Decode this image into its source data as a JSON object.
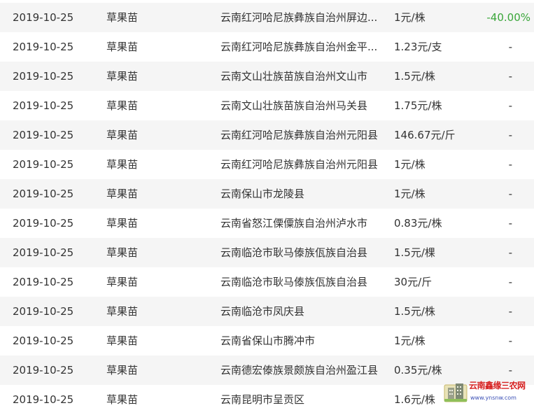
{
  "rows": [
    {
      "date": "2019-10-25",
      "product": "草果苗",
      "region": "云南红河哈尼族彝族自治州屏边...",
      "price": "1元/株",
      "change": "-40.00%"
    },
    {
      "date": "2019-10-25",
      "product": "草果苗",
      "region": "云南红河哈尼族彝族自治州金平...",
      "price": "1.23元/支",
      "change": "-"
    },
    {
      "date": "2019-10-25",
      "product": "草果苗",
      "region": "云南文山壮族苗族自治州文山市",
      "price": "1.5元/株",
      "change": "-"
    },
    {
      "date": "2019-10-25",
      "product": "草果苗",
      "region": "云南文山壮族苗族自治州马关县",
      "price": "1.75元/株",
      "change": "-"
    },
    {
      "date": "2019-10-25",
      "product": "草果苗",
      "region": "云南红河哈尼族彝族自治州元阳县",
      "price": "146.67元/斤",
      "change": "-"
    },
    {
      "date": "2019-10-25",
      "product": "草果苗",
      "region": "云南红河哈尼族彝族自治州元阳县",
      "price": "1元/株",
      "change": "-"
    },
    {
      "date": "2019-10-25",
      "product": "草果苗",
      "region": "云南保山市龙陵县",
      "price": "1元/株",
      "change": "-"
    },
    {
      "date": "2019-10-25",
      "product": "草果苗",
      "region": "云南省怒江傈僳族自治州泸水市",
      "price": "0.83元/株",
      "change": "-"
    },
    {
      "date": "2019-10-25",
      "product": "草果苗",
      "region": "云南临沧市耿马傣族佤族自治县",
      "price": "1.5元/棵",
      "change": "-"
    },
    {
      "date": "2019-10-25",
      "product": "草果苗",
      "region": "云南临沧市耿马傣族佤族自治县",
      "price": "30元/斤",
      "change": "-"
    },
    {
      "date": "2019-10-25",
      "product": "草果苗",
      "region": "云南临沧市凤庆县",
      "price": "1.5元/株",
      "change": "-"
    },
    {
      "date": "2019-10-25",
      "product": "草果苗",
      "region": "云南省保山市腾冲市",
      "price": "1元/株",
      "change": "-"
    },
    {
      "date": "2019-10-25",
      "product": "草果苗",
      "region": "云南德宏傣族景颇族自治州盈江县",
      "price": "0.35元/株",
      "change": "-"
    },
    {
      "date": "2019-10-25",
      "product": "草果苗",
      "region": "云南昆明市呈贡区",
      "price": "1.6元/株",
      "change": ""
    }
  ],
  "watermark": {
    "title": "云南鑫缘三农网",
    "url": "www.ynsnw.com",
    "icon": "building-logo-icon"
  },
  "colors": {
    "row_alt_bg": "#f5f5f5",
    "text": "#333333",
    "change_positive": "#3aa63a",
    "watermark_title": "#d61f1f",
    "watermark_url": "#3a4fb5"
  }
}
